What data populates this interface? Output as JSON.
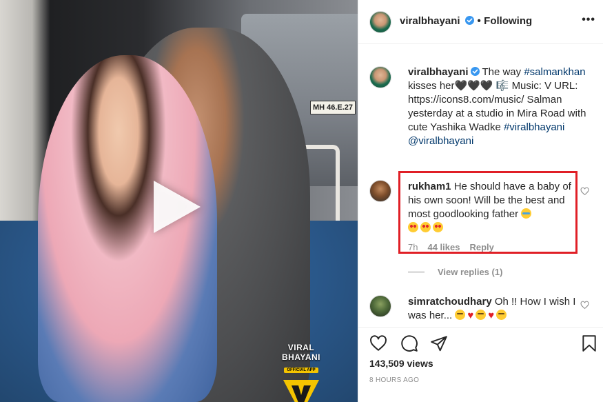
{
  "media": {
    "plate_text": "MH 46.E.27",
    "watermark_line1": "VIRAL BHAYANI",
    "watermark_line2": "OFFICIAL APP",
    "play_icon": "play-icon"
  },
  "header": {
    "username": "viralbhayani",
    "dot": "•",
    "following_label": "Following",
    "more_icon": "more-horizontal-icon"
  },
  "caption": {
    "username": "viralbhayani",
    "text_pre": "The way ",
    "hashtag1": "#salmankhan",
    "text_mid": " kisses her🖤🖤🖤 🎼 Music: V URL: https://icons8.com/music/ Salman yesterday at a studio in Mira Road with cute Yashika Wadke ",
    "hashtag2": "#viralbhayani",
    "mention": "@viralbhayani"
  },
  "comments": [
    {
      "username": "rukham1",
      "text": "He should have a baby of his own soon! Will be the best and most goodlooking father",
      "time": "7h",
      "likes": "44 likes",
      "reply": "Reply",
      "view_replies": "View replies (1)"
    },
    {
      "username": "simratchoudhary",
      "text": "Oh !! How I wish I was her..."
    }
  ],
  "actions": {
    "like_icon": "heart-icon",
    "comment_icon": "comment-icon",
    "share_icon": "share-icon",
    "save_icon": "bookmark-icon",
    "views": "143,509 views",
    "time_ago": "8 HOURS AGO"
  },
  "colors": {
    "verified": "#3897f0",
    "link": "#00376b",
    "highlight_border": "#e01f26",
    "muted": "#8e8e8e"
  }
}
